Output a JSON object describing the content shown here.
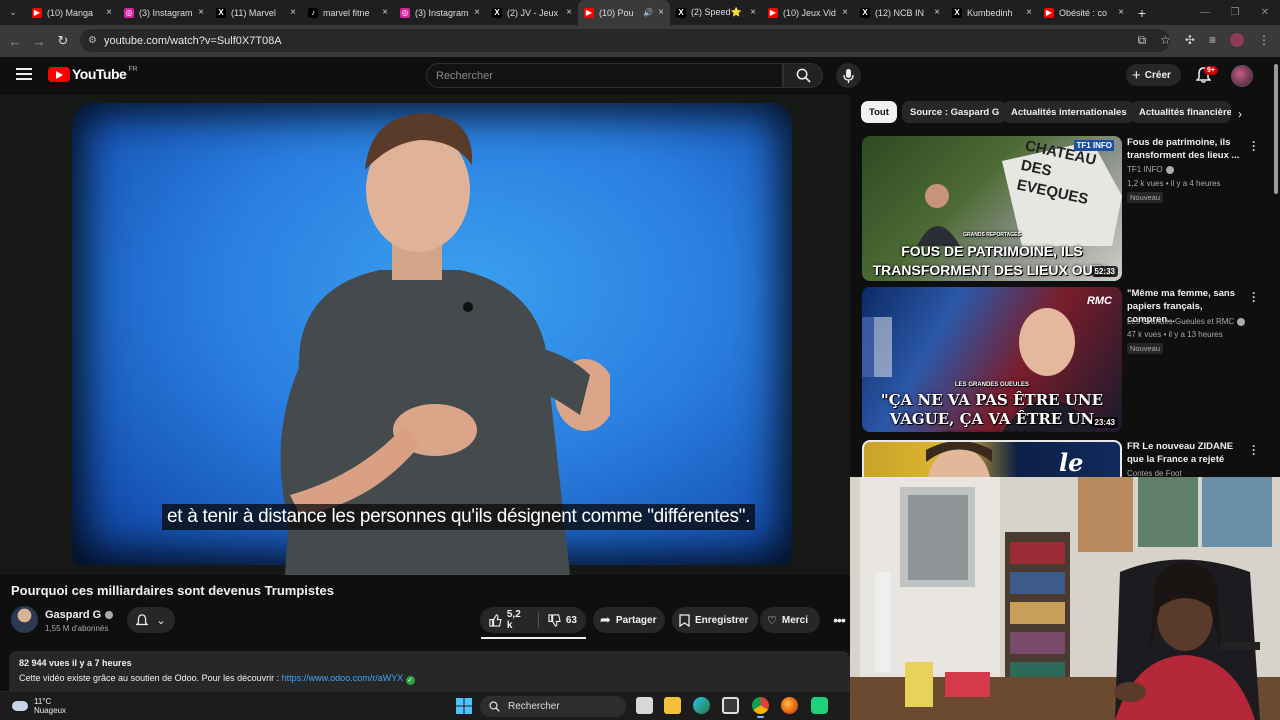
{
  "browser": {
    "tabs": [
      {
        "title": "(10) Manga",
        "favicon": "youtube-icon",
        "color": "#ff0000",
        "glyph": "▶"
      },
      {
        "title": "(3) Instagram",
        "favicon": "instagram-icon",
        "color": "#d6249f",
        "glyph": "◎"
      },
      {
        "title": "(11) Marvel",
        "favicon": "x-icon",
        "color": "#000000",
        "glyph": "X"
      },
      {
        "title": "marvel fitne",
        "favicon": "tiktok-icon",
        "color": "#000000",
        "glyph": "♪"
      },
      {
        "title": "(3) Instagram",
        "favicon": "instagram-icon",
        "color": "#d6249f",
        "glyph": "◎"
      },
      {
        "title": "(2) JV - Jeux",
        "favicon": "x-icon",
        "color": "#000000",
        "glyph": "X"
      },
      {
        "title": "(10) Pou",
        "favicon": "youtube-icon",
        "color": "#ff0000",
        "glyph": "▶",
        "active": true
      },
      {
        "title": "(2) Speed⭐",
        "favicon": "x-icon",
        "color": "#000000",
        "glyph": "X"
      },
      {
        "title": "(10) Jeux Vid",
        "favicon": "youtube-icon",
        "color": "#ff0000",
        "glyph": "▶"
      },
      {
        "title": "(12) NCB IN",
        "favicon": "x-icon",
        "color": "#000000",
        "glyph": "X"
      },
      {
        "title": "Kumbedinh",
        "favicon": "x-icon",
        "color": "#000000",
        "glyph": "X"
      },
      {
        "title": "Obésité : co",
        "favicon": "youtube-icon",
        "color": "#ff0000",
        "glyph": "▶"
      }
    ],
    "url": "youtube.com/watch?v=Sulf0X7T08A"
  },
  "youtube": {
    "logo_text": "YouTube",
    "region": "FR",
    "search_placeholder": "Rechercher",
    "create_label": "Créer",
    "notif_count": "9+"
  },
  "video": {
    "subtitle": "et à tenir à distance les personnes qu'ils désignent comme \"différentes\".",
    "title": "Pourquoi ces milliardaires sont devenus Trumpistes",
    "channel": "Gaspard G",
    "subscribers": "1,55 M d'abonnés",
    "likes": "5,2 k",
    "dislikes": "63",
    "share_label": "Partager",
    "save_label": "Enregistrer",
    "thanks_label": "Merci",
    "views_date": "82 944 vues  il y a 7 heures",
    "description": "Cette vidéo existe grâce au soutien de Odoo. Pour les découvrir : ",
    "description_link": "https://www.odoo.com/r/aWYX"
  },
  "chips": [
    "Tout",
    "Source : Gaspard G",
    "Actualités internationales",
    "Actualités financières"
  ],
  "recommendations": [
    {
      "title": "Fous de patrimoine, ils transforment des lieux ...",
      "channel": "TF1 INFO",
      "meta": "1,2 k vues • il y a 4 heures",
      "badge": "Nouveau",
      "duration": "52:33",
      "thumb_text": "FOUS DE PATRIMOINE, ILS TRANSFORMENT DES LIEUX OUBL",
      "thumb_small": "GRANDS REPORTAGES",
      "sign_text": "CHATEAU DES EVEQUES",
      "logo": "TF1 INFO"
    },
    {
      "title": "\"Même ma femme, sans papiers français, compren...",
      "channel": "Les Grandes Gueules et RMC",
      "meta": "47 k vues • il y a 13 heures",
      "badge": "Nouveau",
      "duration": "23:43",
      "thumb_text": "\"ÇA NE VA PAS ÊTRE UNE VAGUE, ÇA VA ÊTRE UN TSUNAMI.\"",
      "thumb_small": "LES GRANDES GUEULES",
      "logo": "RMC"
    },
    {
      "title": "FR Le nouveau ZIDANE que la France a rejeté",
      "channel": "Contes de Foot",
      "thumb_text": "le"
    }
  ],
  "taskbar": {
    "temperature": "11°C",
    "weather": "Nuageux",
    "search_label": "Rechercher"
  },
  "colors": {
    "accent": "#ff0000",
    "link": "#3ea6ff",
    "background": "#0f0f0f",
    "chip_bg": "#272727"
  }
}
